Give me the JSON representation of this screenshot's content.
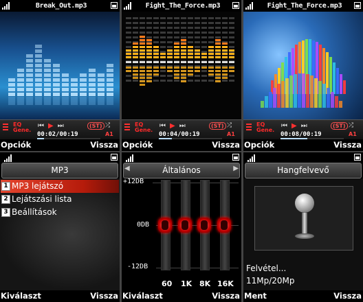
{
  "players": [
    {
      "title": "Break_Out.mp3",
      "time": "00:02/00:19",
      "progress": 0.11,
      "left_softkey": "Opciók",
      "right_softkey": "Vissza"
    },
    {
      "title": "Fight_The_Force.mp3",
      "time": "00:04/00:19",
      "progress": 0.21,
      "left_softkey": "Opciók",
      "right_softkey": "Vissza"
    },
    {
      "title": "Fight_The_Force.mp3",
      "time": "00:08/00:19",
      "progress": 0.42,
      "left_softkey": "Opciók",
      "right_softkey": "Vissza"
    }
  ],
  "player_controls": {
    "eq_label": "EQ",
    "eq_mode": "Gene.",
    "stereo": "(ST)",
    "repeat": "A1"
  },
  "menu": {
    "title": "MP3",
    "items": [
      {
        "num": "1",
        "label": "MP3 lejátszó",
        "selected": true
      },
      {
        "num": "2",
        "label": "Lejátszási lista",
        "selected": false
      },
      {
        "num": "3",
        "label": "Beállítások",
        "selected": false
      }
    ],
    "left_softkey": "Kiválaszt",
    "right_softkey": "Vissza"
  },
  "equalizer": {
    "title": "Általános",
    "db_labels": [
      "+12DB",
      "0DB",
      "-12DB"
    ],
    "bands": [
      {
        "freq": "60",
        "level_db": 0
      },
      {
        "freq": "1K",
        "level_db": 0
      },
      {
        "freq": "8K",
        "level_db": 0
      },
      {
        "freq": "16K",
        "level_db": 0
      }
    ],
    "left_softkey": "Kiválaszt",
    "right_softkey": "Vissza"
  },
  "recorder": {
    "title": "Hangfelvevő",
    "status": "Felvétel...",
    "info": "11Mp/20Mp",
    "left_softkey": "Ment",
    "right_softkey": "Vissza"
  },
  "colors": {
    "accent_red": "#e5452e",
    "eq_knob": "#c00000"
  }
}
